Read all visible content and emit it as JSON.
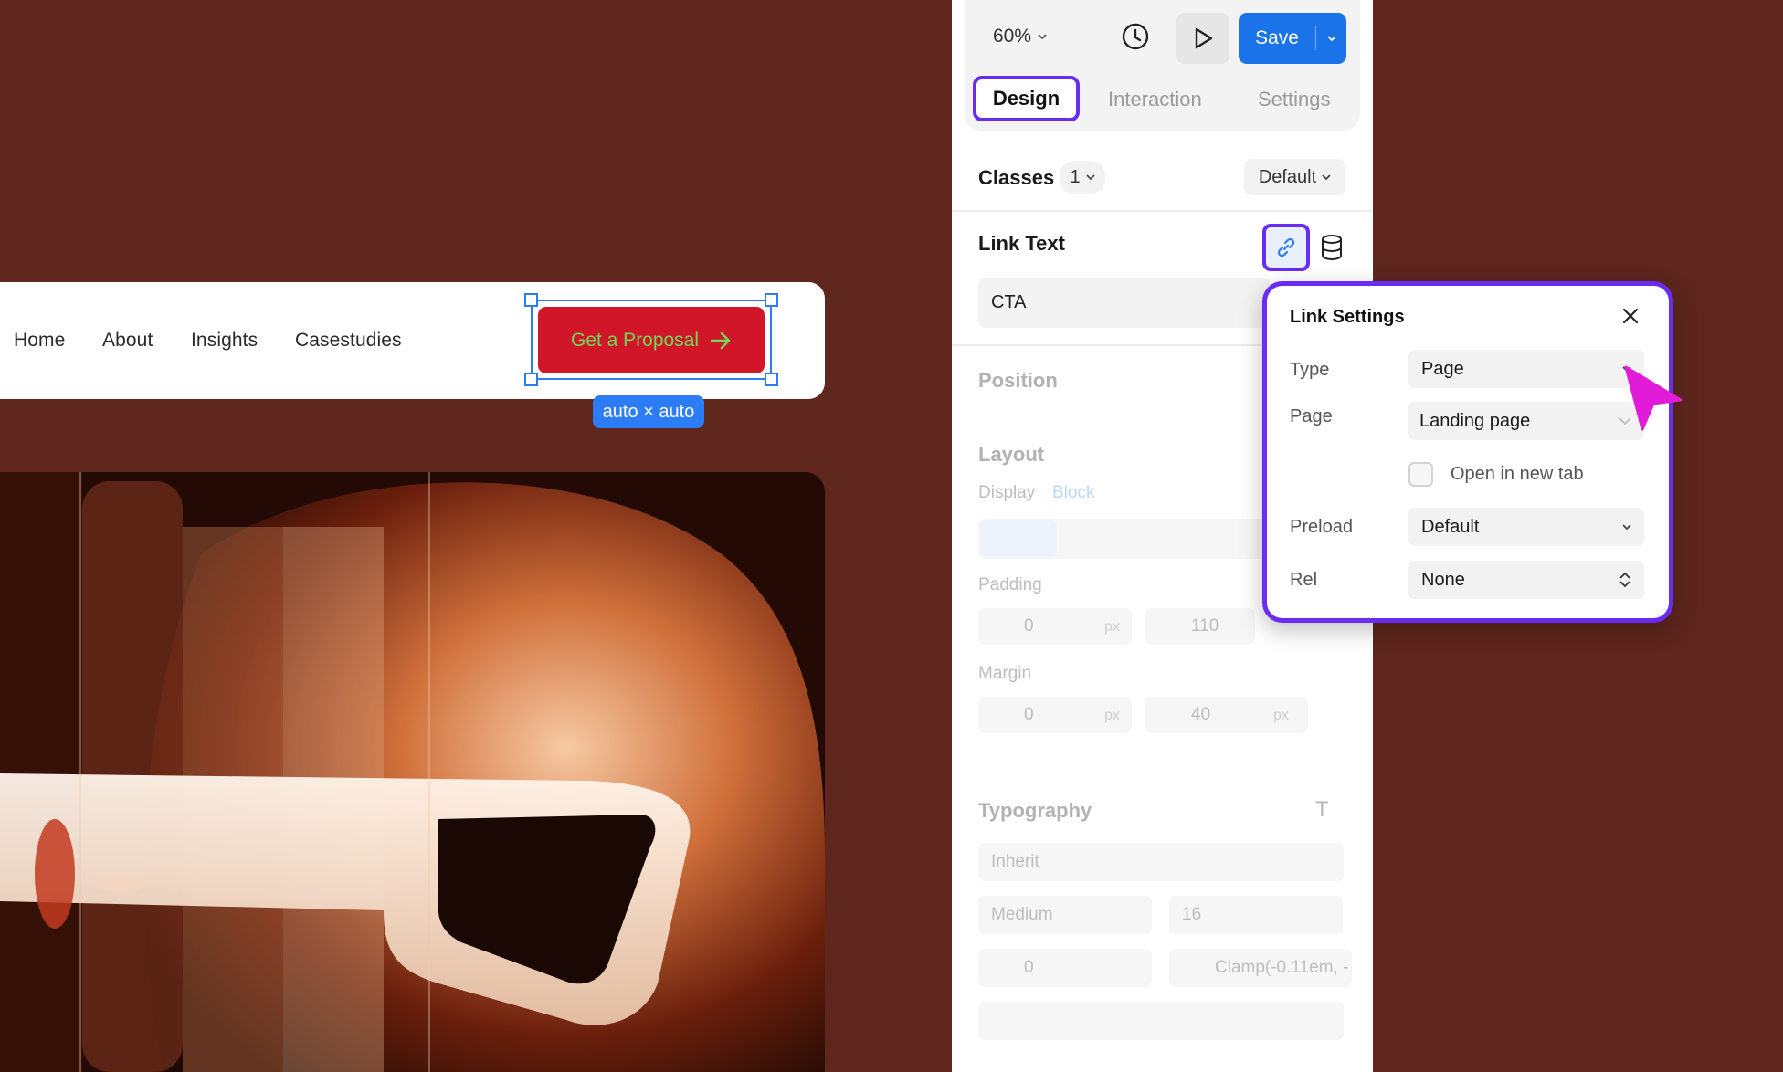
{
  "canvas": {
    "nav_links": [
      "Home",
      "About",
      "Insights",
      "Casestudies"
    ],
    "cta_label": "Get a Proposal",
    "size_badge": "auto × auto"
  },
  "toolbar": {
    "zoom": "60%",
    "save_label": "Save",
    "tabs": [
      "Design",
      "Interaction",
      "Settings"
    ],
    "active_tab": "Design"
  },
  "classes": {
    "label": "Classes",
    "count": "1",
    "state": "Default"
  },
  "link_text": {
    "label": "Link Text",
    "value": "CTA"
  },
  "sections": {
    "position": "Position",
    "layout": "Layout",
    "display_label": "Display",
    "display_value": "Block",
    "padding": "Padding",
    "padding_left": "0",
    "padding_top": "110",
    "margin": "Margin",
    "margin_left": "0",
    "margin_top": "40",
    "unit": "px",
    "typography": "Typography",
    "font_family": "Inherit",
    "font_weight": "Medium",
    "font_size": "16",
    "line_height": "0",
    "letter_spacing": "Clamp(-0.11em, -"
  },
  "link_settings": {
    "title": "Link Settings",
    "type_label": "Type",
    "type_value": "Page",
    "page_label": "Page",
    "page_value": "Landing page",
    "new_tab_label": "Open in new tab",
    "new_tab_checked": false,
    "preload_label": "Preload",
    "preload_value": "Default",
    "rel_label": "Rel",
    "rel_value": "None"
  },
  "colors": {
    "canvas_bg": "#5e261d",
    "cta_bg": "#d1162a",
    "cta_text": "#6fd957",
    "selection": "#2b7cf6",
    "highlight": "#6a2cf0",
    "save_bg": "#1a73e8",
    "cursor": "#e21bd8"
  }
}
